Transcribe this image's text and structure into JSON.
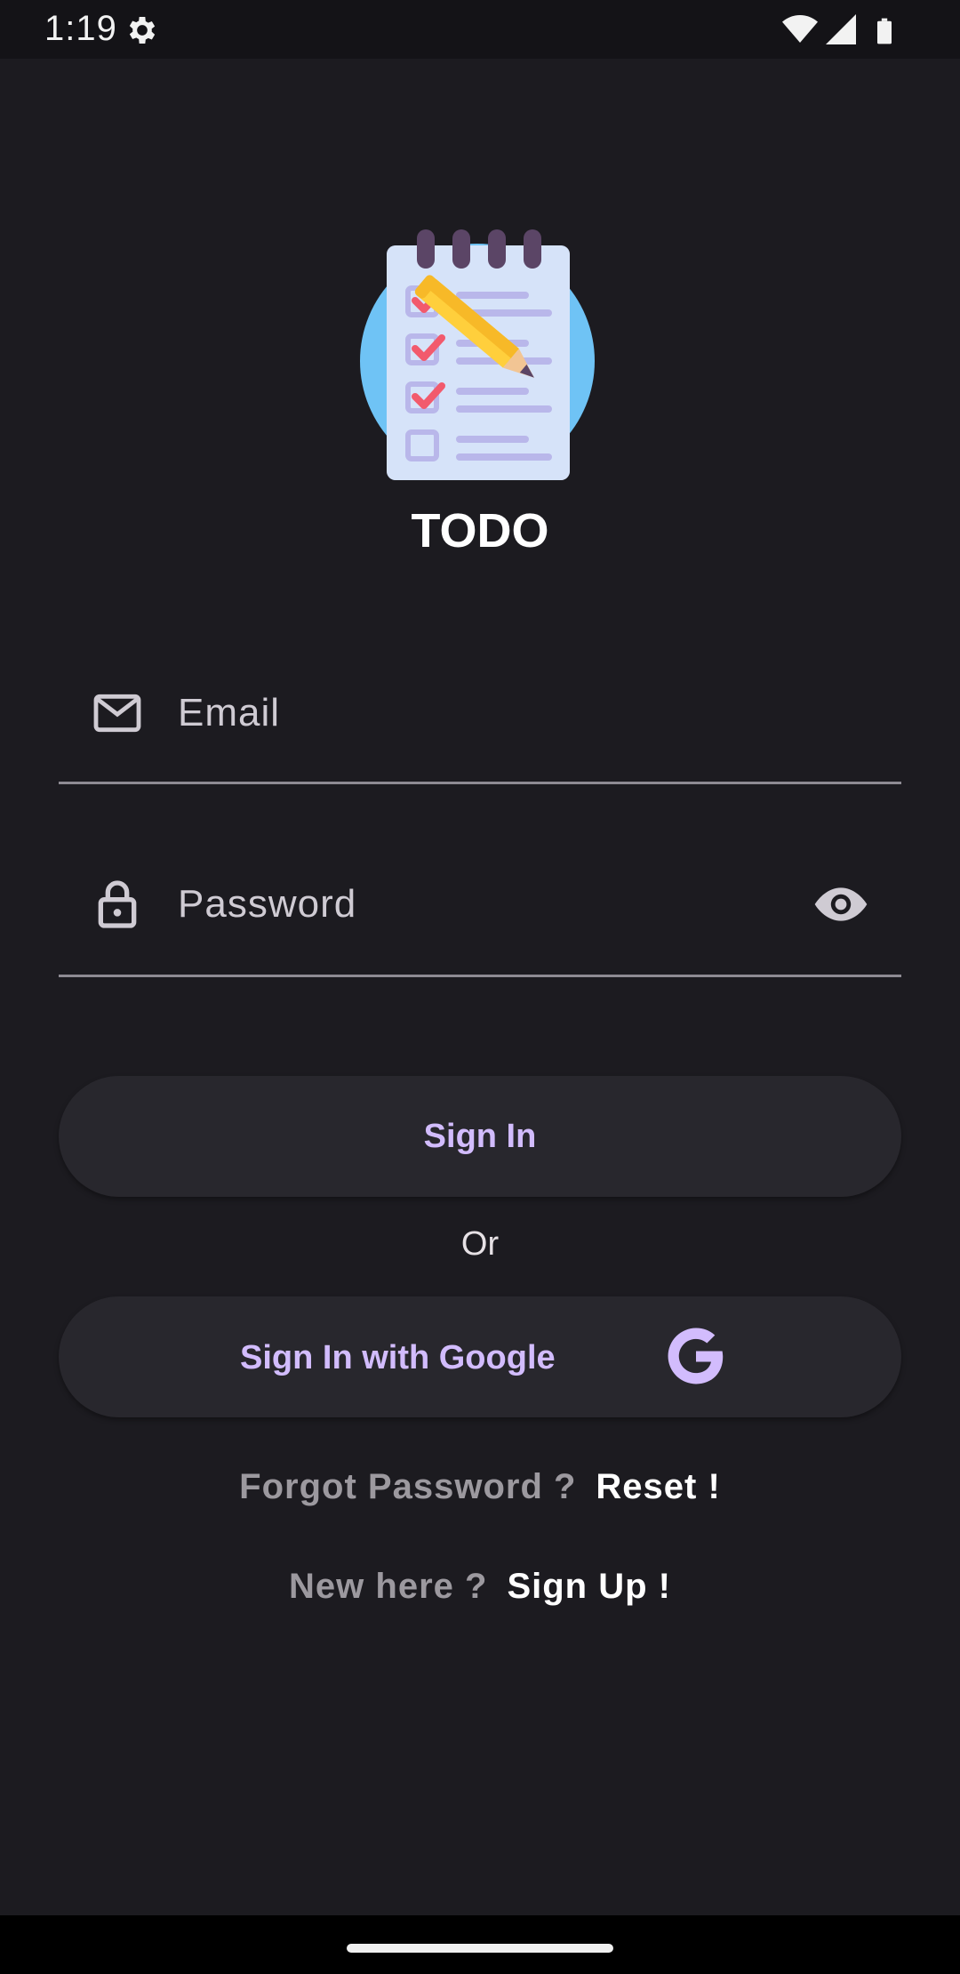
{
  "status_bar": {
    "time": "1:19",
    "icons": [
      "gear-icon",
      "wifi-icon",
      "signal-icon",
      "battery-icon"
    ]
  },
  "app": {
    "logo_icon": "notepad-checklist-pencil-icon",
    "title": "TODO"
  },
  "email_field": {
    "icon": "mail-icon",
    "placeholder": "Email",
    "value": ""
  },
  "password_field": {
    "icon": "lock-icon",
    "placeholder": "Password",
    "value": "",
    "toggle_icon": "eye-icon"
  },
  "sign_in_button": {
    "label": "Sign In"
  },
  "or_text": "Or",
  "google_button": {
    "label": "Sign In with Google",
    "icon": "google-g-icon"
  },
  "forgot_row": {
    "prompt": "Forgot Password ?",
    "action": "Reset !"
  },
  "signup_row": {
    "prompt": "New here ?",
    "action": "Sign Up !"
  },
  "colors": {
    "background": "#1c1b20",
    "button_surface": "#28272d",
    "accent": "#d2bcfd",
    "muted_text": "#9c999f"
  }
}
